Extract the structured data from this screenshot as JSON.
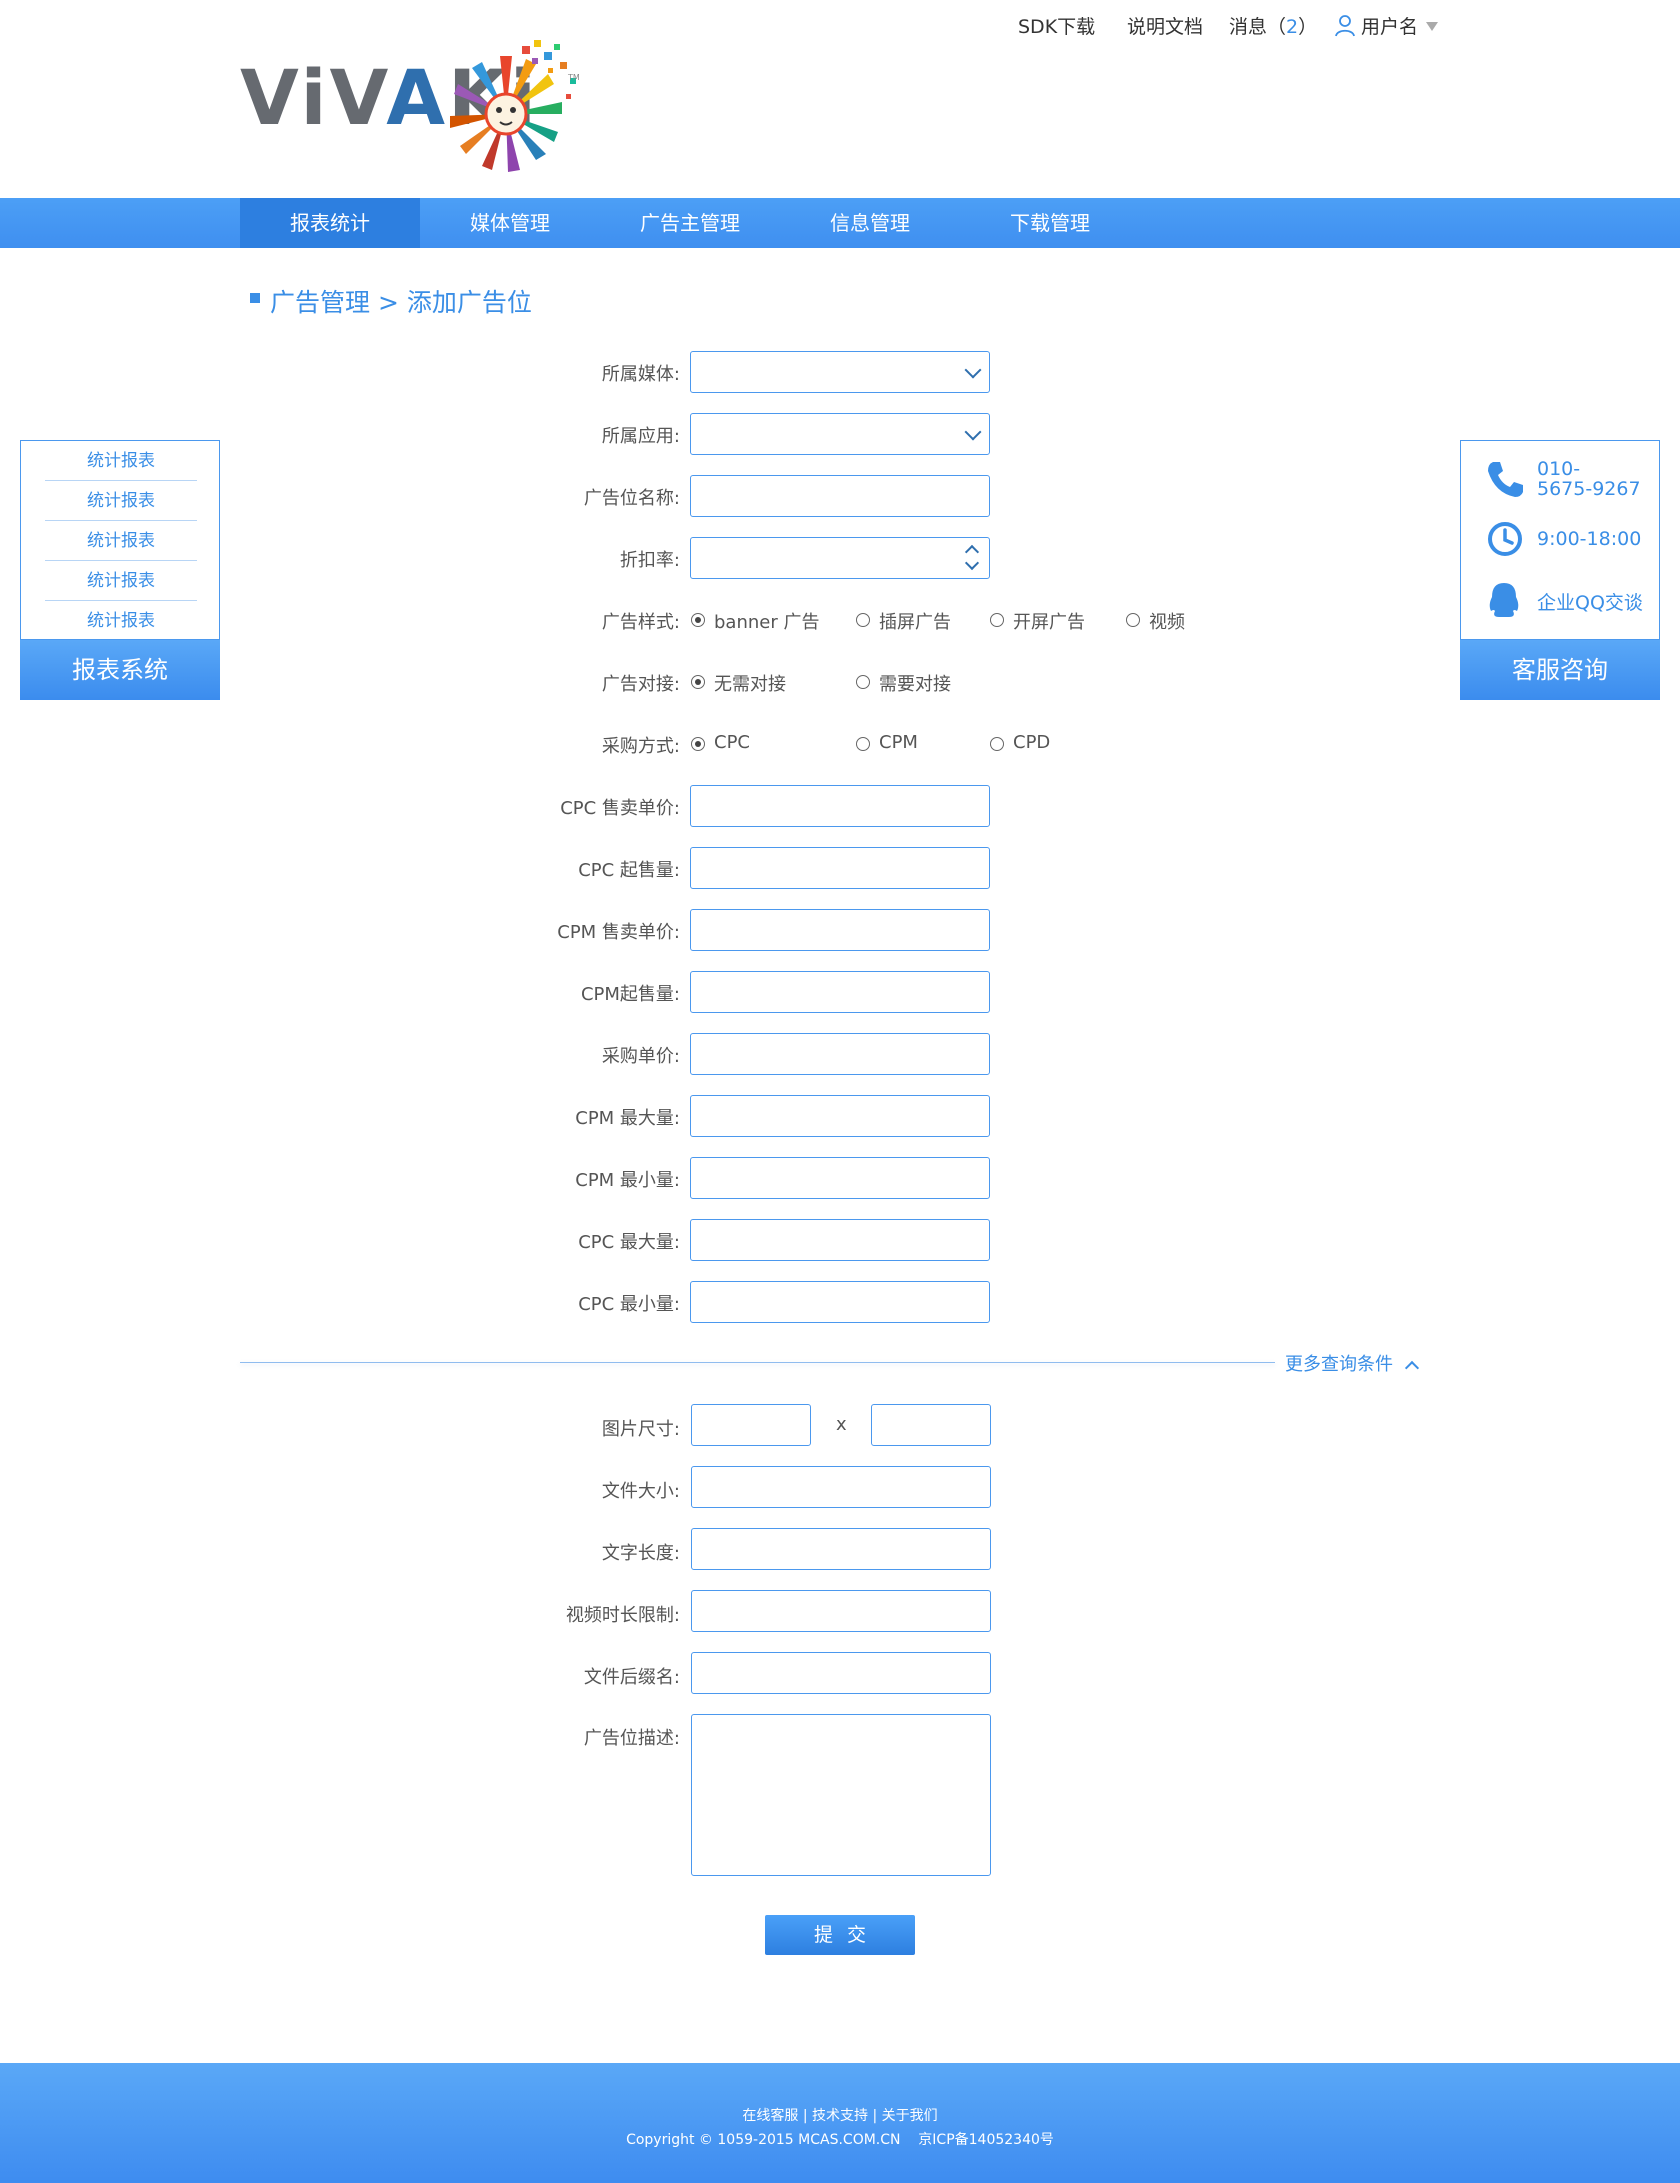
{
  "topbar": {
    "sdk": "SDK下载",
    "docs": "说明文档",
    "messages_label": "消息",
    "messages_open": "（",
    "messages_count": "2",
    "messages_close": "）",
    "username": "用户名"
  },
  "logo": {
    "text_pre": "ViV",
    "text_a": "A",
    "text_post": "Ki",
    "tm": "TM"
  },
  "nav": {
    "items": [
      {
        "label": "报表统计",
        "active": true
      },
      {
        "label": "媒体管理"
      },
      {
        "label": "广告主管理"
      },
      {
        "label": "信息管理"
      },
      {
        "label": "下载管理"
      }
    ]
  },
  "breadcrumb": "广告管理 > 添加广告位",
  "left_panel": {
    "links": [
      "统计报表",
      "统计报表",
      "统计报表",
      "统计报表",
      "统计报表"
    ],
    "title": "报表系统"
  },
  "right_panel": {
    "phone": [
      "010-",
      "5675-9267"
    ],
    "hours": "9:00-18:00",
    "qq": "企业QQ交谈",
    "title": "客服咨询"
  },
  "form": {
    "media_label": "所属媒体:",
    "app_label": "所属应用:",
    "slot_name_label": "广告位名称:",
    "discount_label": "折扣率:",
    "style_label": "广告样式:",
    "style_options": [
      "banner 广告",
      "插屏广告",
      "开屏广告",
      "视频"
    ],
    "style_selected": 0,
    "dock_label": "广告对接:",
    "dock_options": [
      "无需对接",
      "需要对接"
    ],
    "dock_selected": 0,
    "purchase_label": "采购方式:",
    "purchase_options": [
      "CPC",
      "CPM",
      "CPD"
    ],
    "purchase_selected": 0,
    "cpc_price_label": "CPC 售卖单价:",
    "cpc_min_sale_label": "CPC 起售量:",
    "cpm_price_label": "CPM 售卖单价:",
    "cpm_min_sale_label": "CPM起售量:",
    "purchase_price_label": "采购单价:",
    "cpm_max_label": "CPM 最大量:",
    "cpm_min_label": "CPM 最小量:",
    "cpc_max_label": "CPC 最大量:",
    "cpc_min_label": "CPC 最小量:",
    "more_conditions": "更多查询条件",
    "image_size_label": "图片尺寸:",
    "size_separator": "x",
    "file_size_label": "文件大小:",
    "text_length_label": "文字长度:",
    "video_duration_label": "视频时长限制:",
    "file_suffix_label": "文件后缀名:",
    "description_label": "广告位描述:",
    "submit": "提交"
  },
  "footer": {
    "links": "在线客服 | 技术支持 | 关于我们",
    "copyright": "Copyright © 1059-2015 MCAS.COM.CN    京ICP备14052340号"
  },
  "colors": {
    "accent": "#3a8ee6",
    "nav": "#4c9ff6",
    "nav_active": "#2d7fe0",
    "field_border": "#4b98ee"
  }
}
